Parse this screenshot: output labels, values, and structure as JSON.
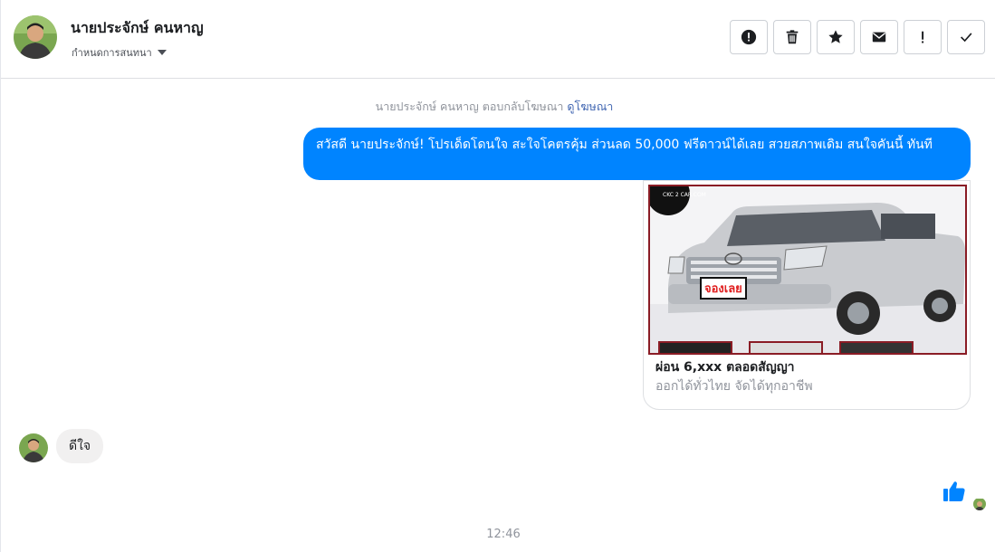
{
  "contact": {
    "name": "นายประจักษ์ คนหาญ",
    "label_dropdown": "กำหนดการสนทนา"
  },
  "toolbar": {
    "icons": [
      "alert-icon",
      "trash-icon",
      "star-icon",
      "envelope-icon",
      "exclamation-icon",
      "check-icon"
    ]
  },
  "conversation": {
    "ad_reply_note": "นายประจักษ์ คนหาญ ตอบกลับโฆษณา",
    "ad_reply_link": "ดูโฆษณา",
    "outgoing_message": "สวัสดี นายประจักษ์! โปรเด็ดโดนใจ สะใจโคตรคุ้ม ส่วนลด 50,000 ฟรีดาวน์ได้เลย สวยสภาพเดิม สนใจคันนี้ ทันที",
    "ad_card": {
      "image_badge": "จองเลย",
      "image_logo": "CKC 2 CAR.COM",
      "title": "ผ่อน 6,xxx ตลอดสัญญา",
      "subtitle": "ออกได้ทั่วไทย จัดได้ทุกอาชีพ"
    },
    "incoming_message": "ดีใจ",
    "timestamp": "12:46"
  },
  "colors": {
    "accent": "#0084ff",
    "incoming_bubble": "#f1f0f0",
    "link": "#4267b2"
  }
}
